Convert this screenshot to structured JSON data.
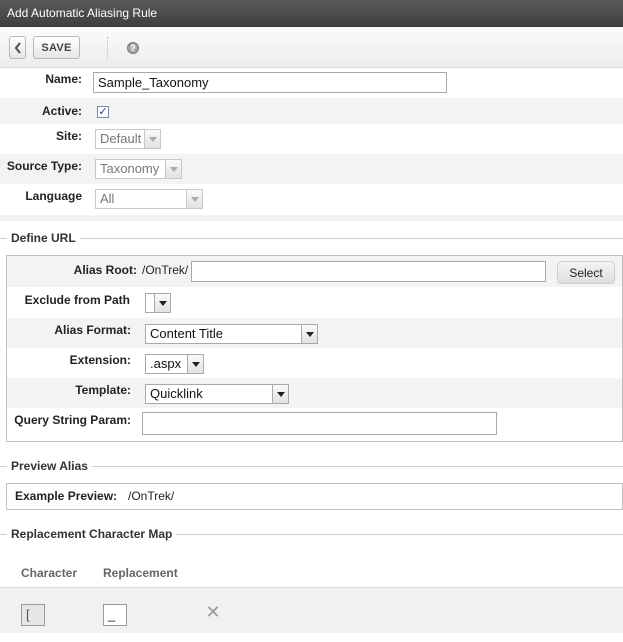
{
  "window": {
    "title": "Add Automatic Aliasing Rule"
  },
  "toolbar": {
    "back_label": "<",
    "save_label": "SAVE",
    "help_label": "?"
  },
  "form": {
    "name": {
      "label": "Name:",
      "value": "Sample_Taxonomy"
    },
    "active": {
      "label": "Active:",
      "checked": true,
      "mark": "✓"
    },
    "site": {
      "label": "Site:",
      "value": "Default"
    },
    "source_type": {
      "label": "Source Type:",
      "value": "Taxonomy"
    },
    "language": {
      "label": "Language",
      "value": "All"
    }
  },
  "define_url": {
    "legend": "Define URL",
    "alias_root": {
      "label": "Alias Root:",
      "prefix": "/OnTrek/",
      "value": "",
      "button": "Select"
    },
    "exclude_from_path": {
      "label": "Exclude from Path",
      "value": ""
    },
    "alias_format": {
      "label": "Alias Format:",
      "value": "Content Title"
    },
    "extension": {
      "label": "Extension:",
      "value": ".aspx"
    },
    "template": {
      "label": "Template:",
      "value": "Quicklink"
    },
    "query_string_param": {
      "label": "Query String Param:",
      "value": ""
    }
  },
  "preview_alias": {
    "legend": "Preview Alias",
    "label": "Example Preview:",
    "value": "/OnTrek/"
  },
  "replacement_map": {
    "legend": "Replacement Character Map",
    "columns": {
      "character": "Character",
      "replacement": "Replacement"
    },
    "rows": [
      {
        "character": "[",
        "replacement": "_"
      }
    ]
  }
}
